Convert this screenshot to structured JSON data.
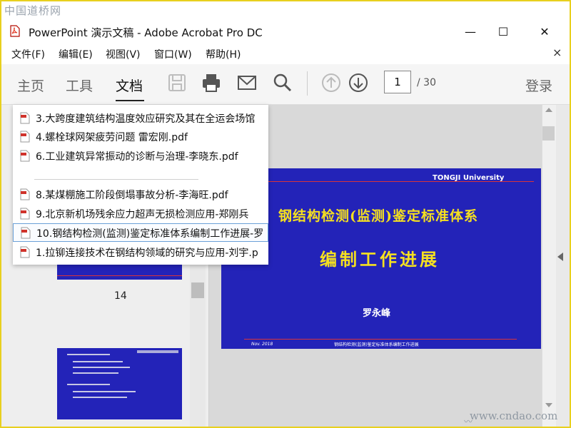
{
  "watermark": {
    "top": "中国道桥网",
    "bottom": "www.cndao.com"
  },
  "window": {
    "title": "PowerPoint 演示文稿 - Adobe Acrobat Pro DC",
    "minimize": "—",
    "maximize": "☐",
    "close": "✕"
  },
  "menu": {
    "items": [
      "文件(F)",
      "编辑(E)",
      "视图(V)",
      "窗口(W)",
      "帮助(H)"
    ],
    "close": "×"
  },
  "toolbar": {
    "tabs": [
      "主页",
      "工具",
      "文档"
    ],
    "active_tab": "文档",
    "page_current": "1",
    "page_total": "/ 30",
    "login": "登录"
  },
  "recent_files": [
    {
      "name": "3.大跨度建筑结构温度效应研究及其在全运会场馆"
    },
    {
      "name": "4.螺栓球网架疲劳问题 雷宏刚.pdf"
    },
    {
      "name": "6.工业建筑异常振动的诊断与治理-李晓东.pdf"
    },
    {
      "name": "8.某煤棚施工阶段倒塌事故分析-李海旺.pdf"
    },
    {
      "name": "9.北京新机场残余应力超声无损检测应用-郑刚兵"
    },
    {
      "name": "10.钢结构检测(监测)鉴定标准体系编制工作进展-罗"
    },
    {
      "name": "1.拉铆连接技术在钢结构领域的研究与应用-刘宇.p"
    }
  ],
  "thumbnail": {
    "page_label": "14"
  },
  "slide": {
    "university": "TONGJI University",
    "title_line1": "钢结构检测(监测)鉴定标准体系",
    "title_line2": "编制工作进展",
    "author": "罗永峰",
    "date": "Nov. 2018",
    "footer": "钢结构检测(监测)鉴定标准体系编制工作进展"
  },
  "colors": {
    "slide_bg": "#2323b8",
    "slide_title": "#f5e020",
    "frame": "#e8d01e"
  }
}
